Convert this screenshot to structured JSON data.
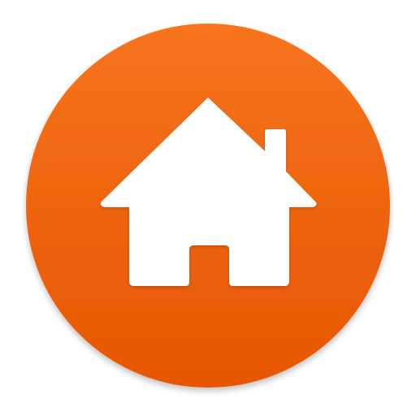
{
  "app_icon": {
    "icon": "home-icon",
    "colors": {
      "badge_top": "#F7741E",
      "badge_bottom": "#E65600",
      "glyph": "#FFFFFF"
    }
  }
}
